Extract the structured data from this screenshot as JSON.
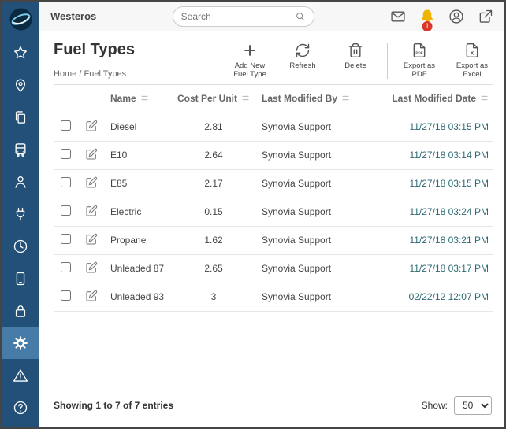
{
  "topbar": {
    "org_name": "Westeros",
    "search_placeholder": "Search",
    "notification_badge": "1"
  },
  "sidebar": {
    "icons": [
      "logo",
      "star",
      "map-pin",
      "copy",
      "bus",
      "person",
      "plug",
      "clock",
      "tablet",
      "lock",
      "gear",
      "warning",
      "help"
    ],
    "active_icon": "gear"
  },
  "page": {
    "title": "Fuel Types",
    "breadcrumb": "Home / Fuel Types"
  },
  "toolbar": {
    "add": "Add New Fuel Type",
    "refresh": "Refresh",
    "delete": "Delete",
    "export_pdf": "Export as PDF",
    "export_excel": "Export as Excel"
  },
  "table": {
    "columns": [
      "Name",
      "Cost Per Unit",
      "Last Modified By",
      "Last Modified Date"
    ],
    "rows": [
      {
        "name": "Diesel",
        "cost_per_unit": "2.81",
        "last_modified_by": "Synovia Support",
        "last_modified_date": "11/27/18 03:15 PM"
      },
      {
        "name": "E10",
        "cost_per_unit": "2.64",
        "last_modified_by": "Synovia Support",
        "last_modified_date": "11/27/18 03:14 PM"
      },
      {
        "name": "E85",
        "cost_per_unit": "2.17",
        "last_modified_by": "Synovia Support",
        "last_modified_date": "11/27/18 03:15 PM"
      },
      {
        "name": "Electric",
        "cost_per_unit": "0.15",
        "last_modified_by": "Synovia Support",
        "last_modified_date": "11/27/18 03:24 PM"
      },
      {
        "name": "Propane",
        "cost_per_unit": "1.62",
        "last_modified_by": "Synovia Support",
        "last_modified_date": "11/27/18 03:21 PM"
      },
      {
        "name": "Unleaded 87",
        "cost_per_unit": "2.65",
        "last_modified_by": "Synovia Support",
        "last_modified_date": "11/27/18 03:17 PM"
      },
      {
        "name": "Unleaded 93",
        "cost_per_unit": "3",
        "last_modified_by": "Synovia Support",
        "last_modified_date": "02/22/12 12:07 PM"
      }
    ]
  },
  "footer": {
    "showing_text": "Showing 1 to 7 of 7 entries",
    "show_label": "Show:",
    "page_size": "50"
  },
  "colors": {
    "sidebar_bg": "#235078",
    "sidebar_active_bg": "#477ca8",
    "bell_yellow": "#f0b400",
    "badge_red": "#d9372a",
    "date_text": "#2e6b75"
  }
}
